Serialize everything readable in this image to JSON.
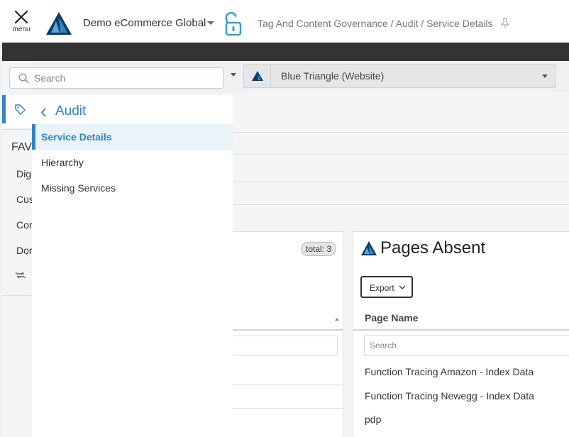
{
  "header": {
    "menu_label": "menu",
    "account_name": "Demo eCommerce Global",
    "breadcrumb": "Tag And Content Governance / Audit / Service Details"
  },
  "filter": {
    "site_selected": "Blue Triangle (Website)"
  },
  "flyout": {
    "search_placeholder": "Search",
    "back_label": "Audit",
    "items": [
      {
        "label": "Service Details",
        "active": true
      },
      {
        "label": "Hierarchy",
        "active": false
      },
      {
        "label": "Missing Services",
        "active": false
      }
    ]
  },
  "rail": {
    "favorites_label": "FAV",
    "items": [
      "Digi",
      "Cus",
      "Cor",
      "Dor"
    ]
  },
  "left_card": {
    "total_badge": "total: 3"
  },
  "pages_absent": {
    "title": "Pages Absent",
    "export_label": "Export",
    "column_header": "Page Name",
    "search_placeholder": "Search",
    "rows": [
      "Function Tracing Amazon - Index Data",
      "Function Tracing Newegg - Index Data",
      "pdp"
    ]
  },
  "colors": {
    "accent": "#2e86c1",
    "logo_dark": "#0d3b66",
    "logo_light": "#2e86c1",
    "dark_bar": "#333333"
  }
}
